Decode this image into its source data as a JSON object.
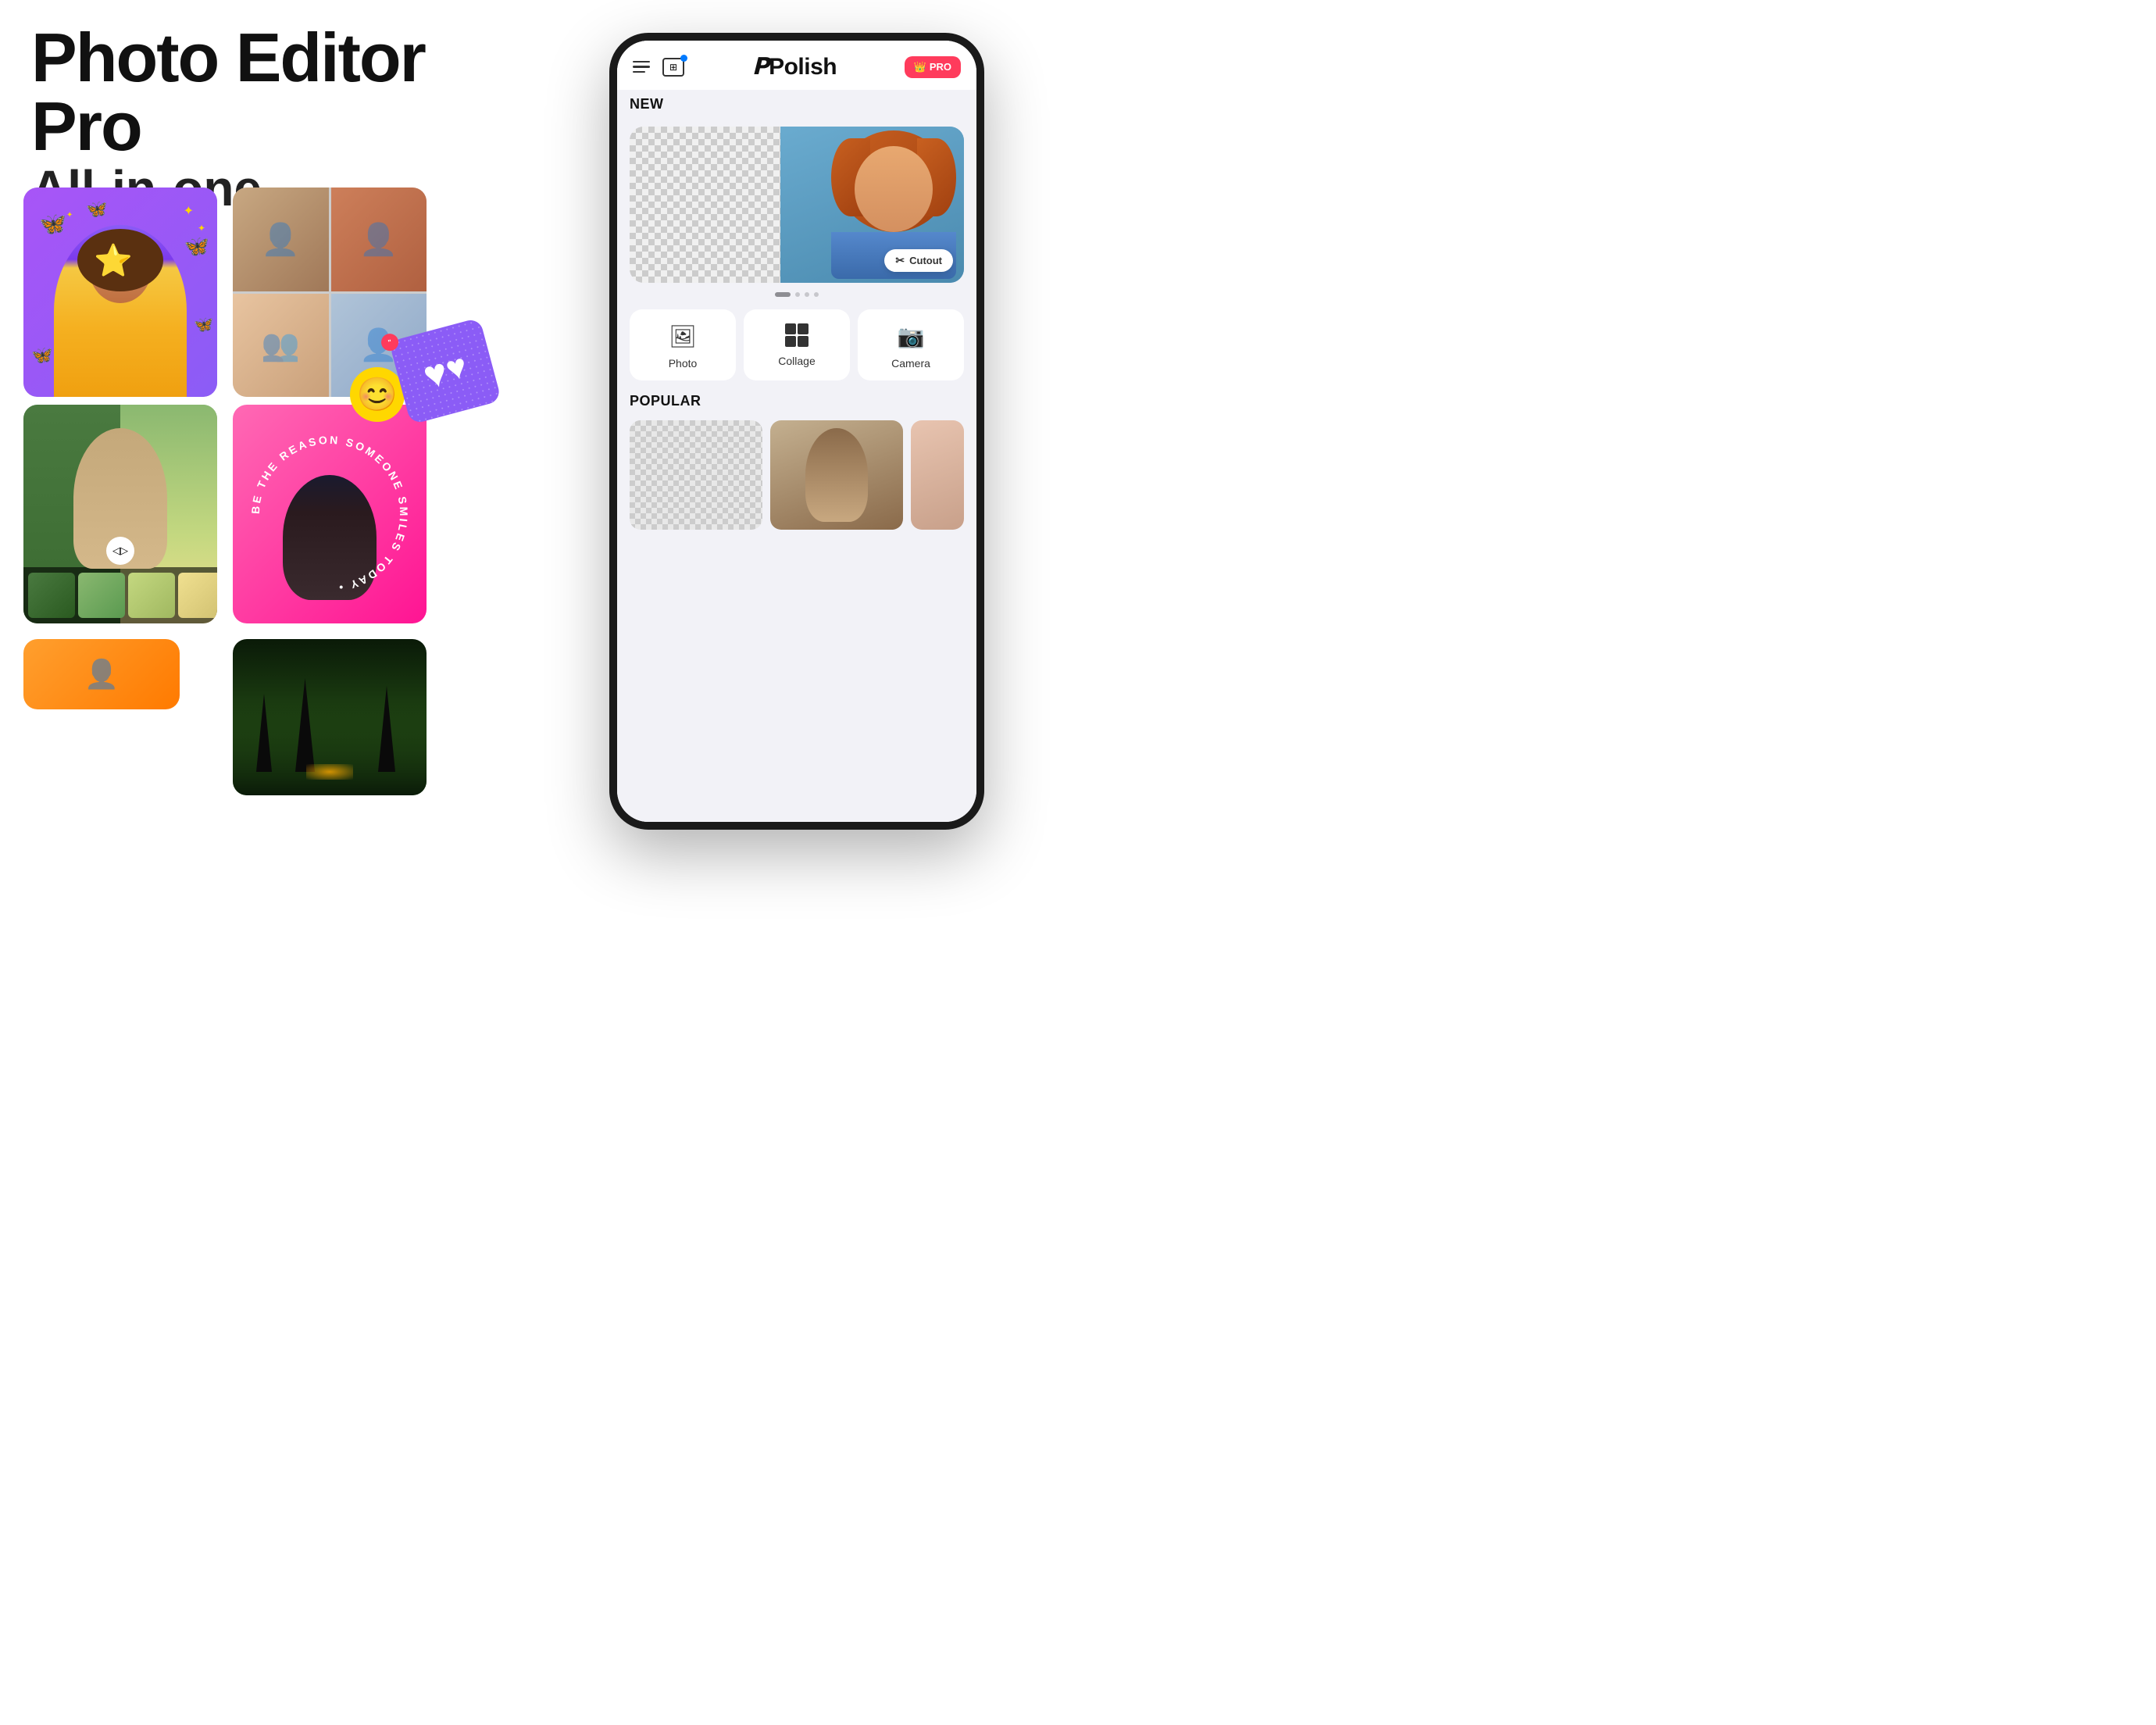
{
  "page": {
    "bg_color": "#ffffff"
  },
  "hero": {
    "title": "Photo Editor Pro",
    "subtitle": "All-in-one"
  },
  "phone": {
    "app_name": "Polish",
    "pro_label": "PRO",
    "section_new": "NEW",
    "section_popular": "POPULAR",
    "cutout_label": "Cutout",
    "actions": [
      {
        "label": "Photo",
        "icon": "🖼"
      },
      {
        "label": "Collage",
        "icon": "⊞"
      },
      {
        "label": "Camera",
        "icon": "📷"
      }
    ],
    "dots": [
      1,
      2,
      3,
      4
    ]
  }
}
